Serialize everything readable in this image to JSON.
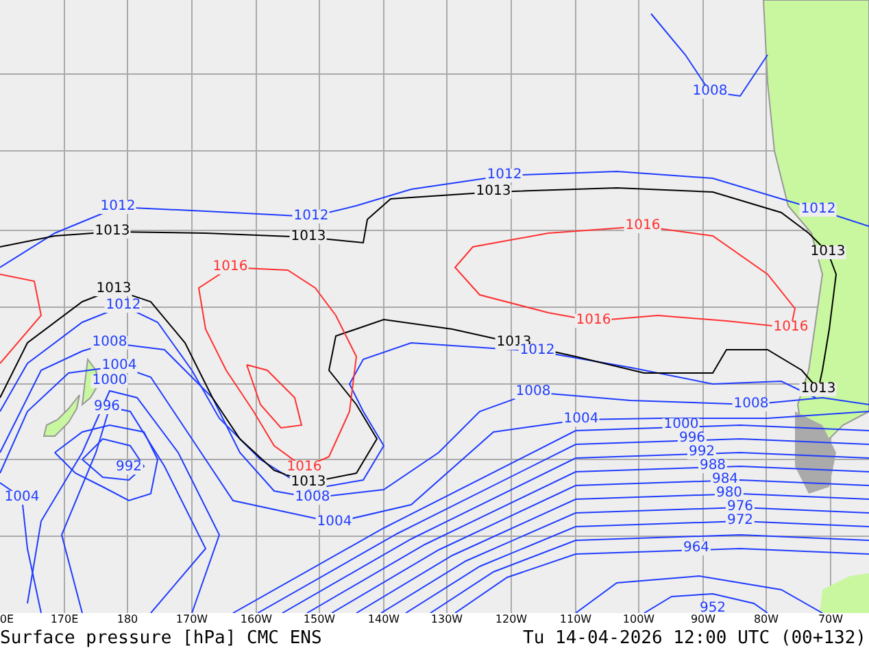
{
  "map": {
    "isobar_labels": [
      {
        "text": "1008",
        "color": "#1f3cff"
      },
      {
        "text": "1012",
        "color": "#1f3cff"
      },
      {
        "text": "1013",
        "color": "#000000"
      },
      {
        "text": "1012",
        "color": "#1f3cff"
      },
      {
        "text": "1012",
        "color": "#1f3cff"
      },
      {
        "text": "1012",
        "color": "#1f3cff"
      },
      {
        "text": "1013",
        "color": "#000000"
      },
      {
        "text": "1013",
        "color": "#000000"
      },
      {
        "text": "1016",
        "color": "#ff3030"
      },
      {
        "text": "1013",
        "color": "#000000"
      },
      {
        "text": "1016",
        "color": "#ff3030"
      },
      {
        "text": "1013",
        "color": "#000000"
      },
      {
        "text": "1012",
        "color": "#1f3cff"
      },
      {
        "text": "1016",
        "color": "#ff3030"
      },
      {
        "text": "1016",
        "color": "#ff3030"
      },
      {
        "text": "1008",
        "color": "#1f3cff"
      },
      {
        "text": "1013",
        "color": "#000000"
      },
      {
        "text": "1012",
        "color": "#1f3cff"
      },
      {
        "text": "1004",
        "color": "#1f3cff"
      },
      {
        "text": "1000",
        "color": "#1f3cff"
      },
      {
        "text": "1008",
        "color": "#1f3cff"
      },
      {
        "text": "1013",
        "color": "#000000"
      },
      {
        "text": "996",
        "color": "#1f3cff"
      },
      {
        "text": "1008",
        "color": "#1f3cff"
      },
      {
        "text": "1004",
        "color": "#1f3cff"
      },
      {
        "text": "1000",
        "color": "#1f3cff"
      },
      {
        "text": "996",
        "color": "#1f3cff"
      },
      {
        "text": "992",
        "color": "#1f3cff"
      },
      {
        "text": "992",
        "color": "#1f3cff"
      },
      {
        "text": "1016",
        "color": "#ff3030"
      },
      {
        "text": "988",
        "color": "#1f3cff"
      },
      {
        "text": "1013",
        "color": "#000000"
      },
      {
        "text": "984",
        "color": "#1f3cff"
      },
      {
        "text": "1004",
        "color": "#1f3cff"
      },
      {
        "text": "1008",
        "color": "#1f3cff"
      },
      {
        "text": "980",
        "color": "#1f3cff"
      },
      {
        "text": "976",
        "color": "#1f3cff"
      },
      {
        "text": "1004",
        "color": "#1f3cff"
      },
      {
        "text": "972",
        "color": "#1f3cff"
      },
      {
        "text": "964",
        "color": "#1f3cff"
      },
      {
        "text": "952",
        "color": "#1f3cff"
      }
    ]
  },
  "longitude_labels": [
    "0E",
    "170E",
    "180",
    "170W",
    "160W",
    "150W",
    "140W",
    "130W",
    "120W",
    "110W",
    "100W",
    "90W",
    "80W",
    "70W"
  ],
  "caption": {
    "title": "Surface pressure [hPa] CMC ENS",
    "valid_time": "Tu 14-04-2026 12:00 UTC (00+132)"
  }
}
